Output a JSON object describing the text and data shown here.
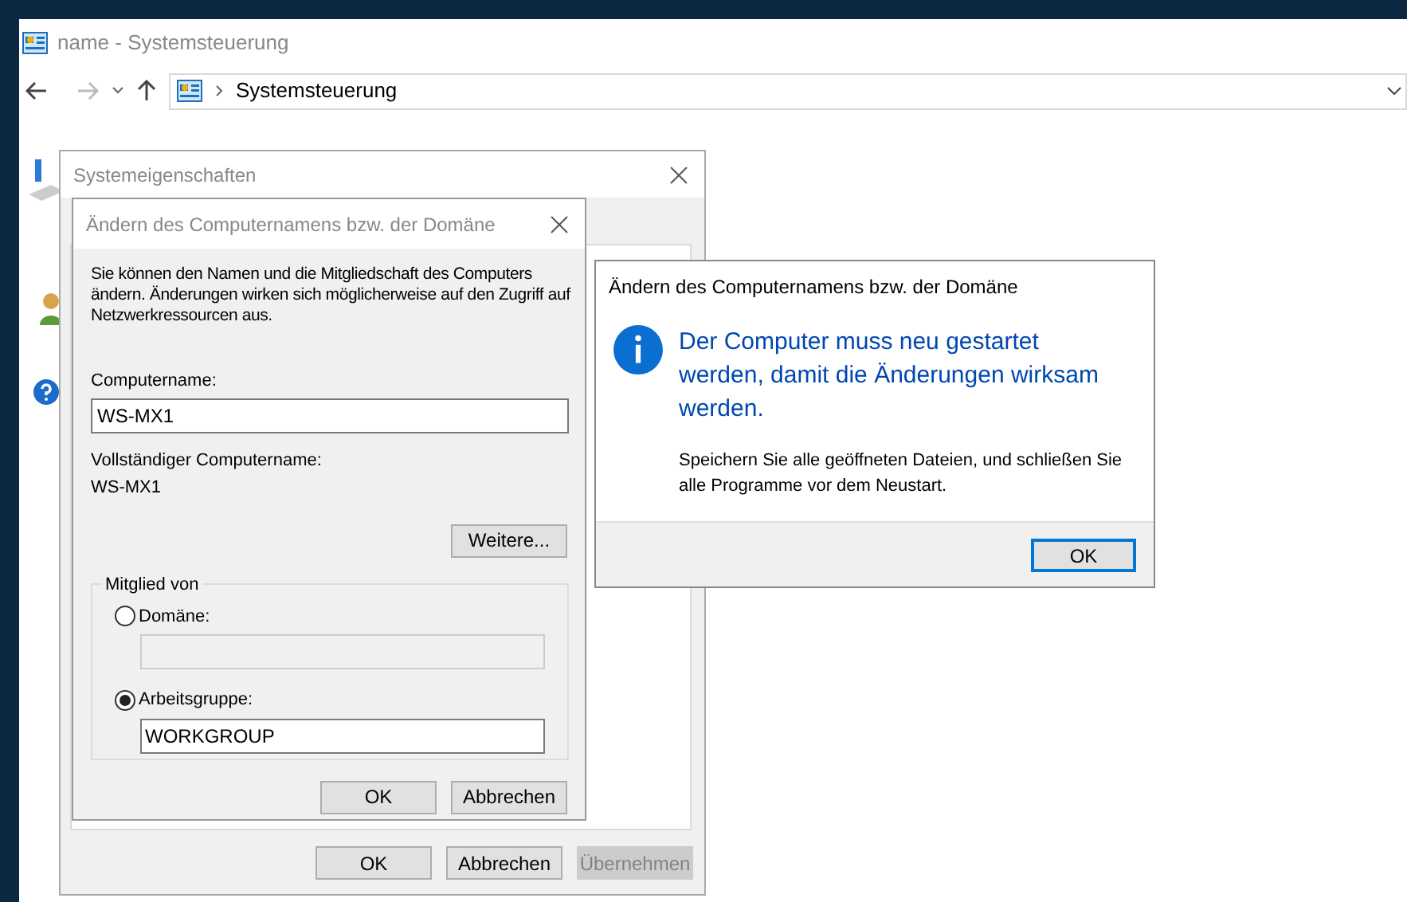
{
  "window": {
    "title": "name - Systemsteuerung",
    "address": "Systemsteuerung"
  },
  "system_properties": {
    "title": "Systemeigenschaften",
    "buttons": [
      {
        "label": "OK",
        "disabled": false
      },
      {
        "label": "Abbrechen",
        "disabled": false
      },
      {
        "label": "Übernehmen",
        "disabled": true
      }
    ]
  },
  "rename_dialog": {
    "title": "Ändern des Computernamens bzw. der Domäne",
    "description": "Sie können den Namen und die Mitgliedschaft des Computers ändern. Änderungen wirken sich möglicherweise auf den Zugriff auf Netzwerkressourcen aus.",
    "computer_name_label": "Computername:",
    "computer_name": "WS-MX1",
    "full_name_label": "Vollständiger Computername:",
    "full_name": "WS-MX1",
    "more_button": "Weitere...",
    "member_of": {
      "label": "Mitglied von",
      "options": [
        {
          "label": "Domäne:",
          "selected": false
        },
        {
          "label": "Arbeitsgruppe:",
          "selected": true,
          "value": "WORKGROUP"
        }
      ]
    },
    "buttons": [
      "OK",
      "Abbrechen"
    ]
  },
  "message_box": {
    "title": "Ändern des Computernamens bzw. der Domäne",
    "main_text": "Der Computer muss neu gestartet werden, damit die Änderungen wirksam werden.",
    "detail_text": "Speichern Sie alle geöffneten Dateien, und schließen Sie alle Programme vor dem Neustart.",
    "button": "OK"
  }
}
